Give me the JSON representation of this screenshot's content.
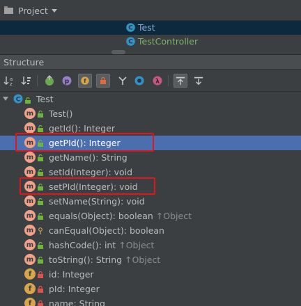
{
  "project_panel": {
    "title": "Project",
    "items": [
      {
        "label": "Test",
        "selected": true
      },
      {
        "label": "TestController",
        "selected": false
      }
    ]
  },
  "structure_panel": {
    "title": "Structure",
    "toolbar": [
      {
        "name": "sort-by-visibility-icon",
        "on": false
      },
      {
        "name": "sort-alphabetically-icon",
        "on": false
      },
      {
        "name": "show-inherited-icon",
        "on": false
      },
      {
        "name": "show-properties-icon",
        "on": false
      },
      {
        "name": "show-fields-icon",
        "on": true
      },
      {
        "name": "show-non-public-icon",
        "on": true
      },
      {
        "name": "show-lambdas-icon",
        "on": false
      },
      {
        "name": "show-anonymous-icon",
        "on": false
      },
      {
        "name": "show-lambda-icon",
        "on": false
      },
      {
        "name": "autoscroll-to-source-icon",
        "on": true
      },
      {
        "name": "autoscroll-from-source-icon",
        "on": false
      }
    ],
    "root": {
      "label": "Test"
    },
    "members": [
      {
        "kind": "m",
        "text": "Test()",
        "inherited": "",
        "visibility": "public"
      },
      {
        "kind": "m",
        "text": "getId(): Integer",
        "inherited": "",
        "visibility": "public"
      },
      {
        "kind": "m",
        "text": "getPId(): Integer",
        "inherited": "",
        "visibility": "public",
        "selected": true
      },
      {
        "kind": "m",
        "text": "getName(): String",
        "inherited": "",
        "visibility": "public"
      },
      {
        "kind": "m",
        "text": "setId(Integer): void",
        "inherited": "",
        "visibility": "public"
      },
      {
        "kind": "m",
        "text": "setPId(Integer): void",
        "inherited": "",
        "visibility": "public"
      },
      {
        "kind": "m",
        "text": "setName(String): void",
        "inherited": "",
        "visibility": "public"
      },
      {
        "kind": "m",
        "text": "equals(Object): boolean ",
        "inherited": "↑Object",
        "visibility": "public"
      },
      {
        "kind": "m",
        "text": "canEqual(Object): boolean",
        "inherited": "",
        "visibility": "protected"
      },
      {
        "kind": "m",
        "text": "hashCode(): int ",
        "inherited": "↑Object",
        "visibility": "public"
      },
      {
        "kind": "m",
        "text": "toString(): String ",
        "inherited": "↑Object",
        "visibility": "public"
      },
      {
        "kind": "f",
        "text": "id: Integer",
        "inherited": "",
        "visibility": "private"
      },
      {
        "kind": "f",
        "text": "pId: Integer",
        "inherited": "",
        "visibility": "private"
      },
      {
        "kind": "f",
        "text": "name: String",
        "inherited": "",
        "visibility": "private"
      }
    ]
  },
  "colors": {
    "background": "#3c3f41",
    "selection": "#4b6eaf",
    "method_icon": "#f0a28a",
    "field_icon": "#d7a54a",
    "public_lock": "#6db33f",
    "private_lock": "#d9534f",
    "highlight_box": "#e0161b"
  }
}
